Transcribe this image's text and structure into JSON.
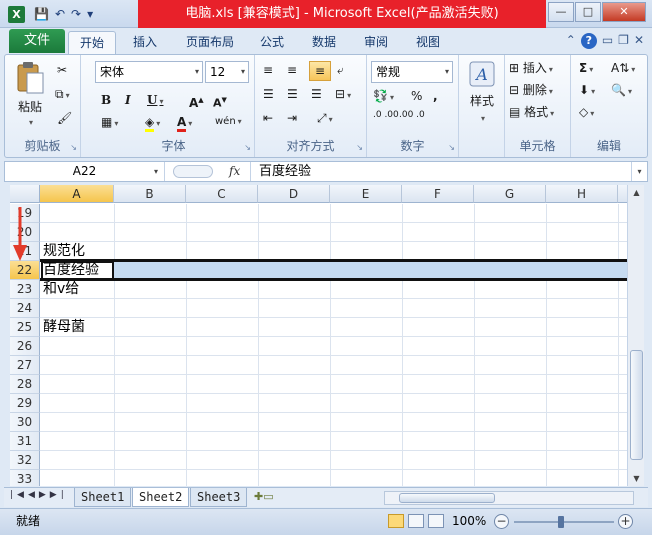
{
  "window": {
    "title": "电脑.xls  [兼容模式]  -  Microsoft Excel(产品激活失败)",
    "app_icon": "X",
    "controls": {
      "minimize": "—",
      "maximize": "□",
      "close": "✕"
    }
  },
  "qat": {
    "save": "💾",
    "undo": "↶",
    "redo": "↷",
    "more": "▾"
  },
  "ribbon_tabs": {
    "file": "文件",
    "tabs": [
      "开始",
      "插入",
      "页面布局",
      "公式",
      "数据",
      "审阅",
      "视图"
    ],
    "active": "开始"
  },
  "ribbon": {
    "clipboard": {
      "label": "剪贴板",
      "paste": "粘贴"
    },
    "font": {
      "label": "字体",
      "name": "宋体",
      "size": "12"
    },
    "alignment": {
      "label": "对齐方式"
    },
    "number": {
      "label": "数字",
      "format": "常规",
      "percent": "%",
      "comma": ",",
      "inc_dec": ".0 .00",
      "dec_dec": ".00 .0"
    },
    "styles": {
      "label": "样式",
      "button": "样式"
    },
    "cells": {
      "label": "单元格",
      "insert": "插入",
      "delete": "删除",
      "format": "格式"
    },
    "editing": {
      "label": "编辑",
      "sum": "Σ"
    }
  },
  "formula_bar": {
    "name_box": "A22",
    "fx": "fx",
    "content": "百度经验"
  },
  "columns": [
    "A",
    "B",
    "C",
    "D",
    "E",
    "F",
    "G",
    "H"
  ],
  "selected_column": "A",
  "rows": [
    "19",
    "20",
    "21",
    "22",
    "23",
    "24",
    "25",
    "26",
    "27",
    "28",
    "29",
    "30",
    "31",
    "32",
    "33"
  ],
  "selected_row": "22",
  "cells": {
    "A21": "规范化",
    "A22": "百度经验",
    "A23": "和v给",
    "A25": "酵母菌"
  },
  "sheets": {
    "tabs": [
      "Sheet1",
      "Sheet2",
      "Sheet3"
    ],
    "active": "Sheet2"
  },
  "status": {
    "mode": "就绪",
    "zoom": "100%",
    "zoom_fraction": 0.5
  },
  "colors": {
    "title_red": "#e8212a",
    "selection_yellow": "#f5c54d",
    "row_highlight": "#c6dbf1",
    "file_tab": "#1b7a3b"
  }
}
